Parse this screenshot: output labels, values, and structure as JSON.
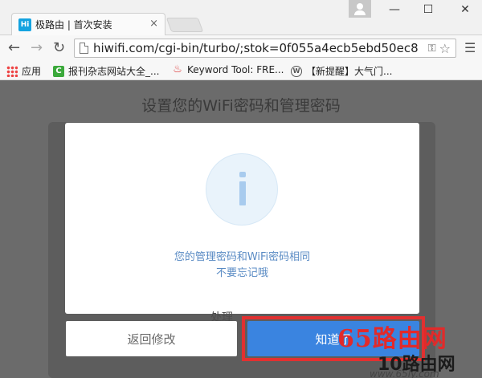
{
  "tab": {
    "favicon_text": "Hi",
    "title": "极路由 | 首次安装",
    "close": "×"
  },
  "window": {
    "minimize": "—",
    "maximize": "☐",
    "close": "✕"
  },
  "address": {
    "url": "hiwifi.com/cgi-bin/turbo/;stok=0f055a4ecb5ebd50ec8"
  },
  "bookmarks": [
    {
      "label": "应用",
      "icon": "apps-grid-icon"
    },
    {
      "label": "报刊杂志网站大全_...",
      "icon": "c-site-icon"
    },
    {
      "label": "Keyword Tool: FRE...",
      "icon": "flame-icon"
    },
    {
      "label": "【新提醒】大气门...",
      "icon": "wordpress-icon"
    }
  ],
  "page": {
    "heading": "设置您的WiFi密码和管理密码",
    "dialog": {
      "line1": "您的管理密码和WiFi密码相同",
      "line2": "不要忘记哦"
    },
    "faded_button_text": "处理",
    "buttons": {
      "back": "返回修改",
      "ok": "知道了"
    }
  },
  "watermark": {
    "brand": "65路由网",
    "partial": "10路由网",
    "url": "www.65ly.com"
  },
  "colors": {
    "primary_button": "#3a84e0",
    "highlight_frame": "#e23030",
    "message_text": "#5a8bc4"
  }
}
